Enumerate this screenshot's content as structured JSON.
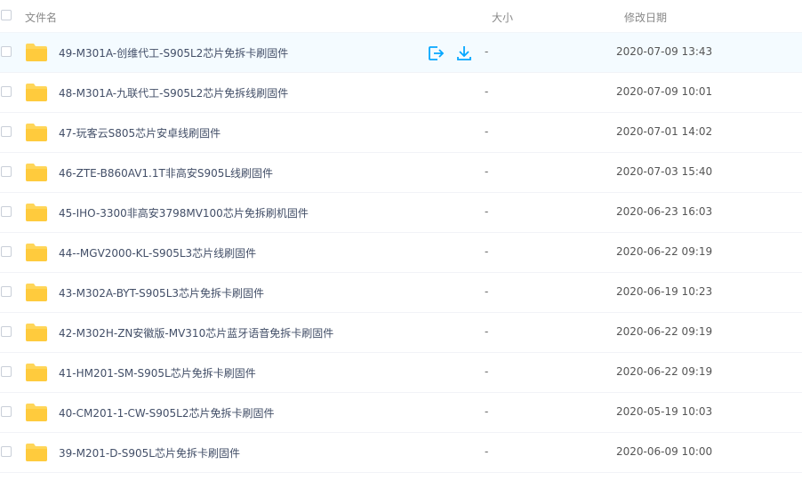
{
  "header": {
    "name_label": "文件名",
    "size_label": "大小",
    "date_label": "修改日期"
  },
  "actions": {
    "share_icon": "share-icon",
    "download_icon": "download-icon"
  },
  "files": [
    {
      "name": "49-M301A-创维代工-S905L2芯片免拆卡刷固件",
      "size": "-",
      "date": "2020-07-09 13:43"
    },
    {
      "name": "48-M301A-九联代工-S905L2芯片免拆线刷固件",
      "size": "-",
      "date": "2020-07-09 10:01"
    },
    {
      "name": "47-玩客云S805芯片安卓线刷固件",
      "size": "-",
      "date": "2020-07-01 14:02"
    },
    {
      "name": "46-ZTE-B860AV1.1T非高安S905L线刷固件",
      "size": "-",
      "date": "2020-07-03 15:40"
    },
    {
      "name": "45-IHO-3300非高安3798MV100芯片免拆刷机固件",
      "size": "-",
      "date": "2020-06-23 16:03"
    },
    {
      "name": "44--MGV2000-KL-S905L3芯片线刷固件",
      "size": "-",
      "date": "2020-06-22 09:19"
    },
    {
      "name": "43-M302A-BYT-S905L3芯片免拆卡刷固件",
      "size": "-",
      "date": "2020-06-19 10:23"
    },
    {
      "name": "42-M302H-ZN安徽版-MV310芯片蓝牙语音免拆卡刷固件",
      "size": "-",
      "date": "2020-06-22 09:19"
    },
    {
      "name": "41-HM201-SM-S905L芯片免拆卡刷固件",
      "size": "-",
      "date": "2020-06-22 09:19"
    },
    {
      "name": "40-CM201-1-CW-S905L2芯片免拆卡刷固件",
      "size": "-",
      "date": "2020-05-19 10:03"
    },
    {
      "name": "39-M201-D-S905L芯片免拆卡刷固件",
      "size": "-",
      "date": "2020-06-09 10:00"
    }
  ],
  "colors": {
    "accent": "#06a7ff",
    "folder": "#ffd659",
    "hover_row": "#f4fbff"
  }
}
